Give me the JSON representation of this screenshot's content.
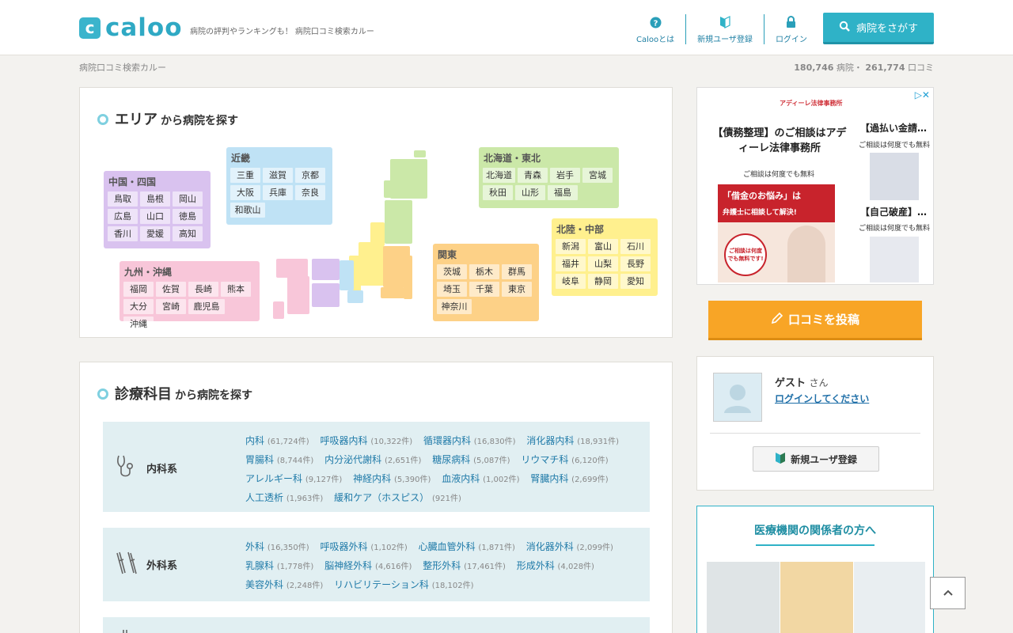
{
  "header": {
    "logo_mark": "c",
    "logo_text": "caloo",
    "tagline": "病院の評判やランキングも！ 病院口コミ検索カルー",
    "nav": [
      {
        "label": "Calooとは",
        "icon": "question-icon"
      },
      {
        "label": "新規ユーザ登録",
        "icon": "beginner-mark-icon"
      },
      {
        "label": "ログイン",
        "icon": "lock-icon"
      }
    ],
    "search_button": "病院をさがす"
  },
  "breadcrumb": "病院口コミ検索カルー",
  "stats": {
    "hospitals": "180,746",
    "hospitals_unit": "病院・",
    "reviews": "261,774",
    "reviews_unit": "口コミ"
  },
  "area": {
    "title_big": "エリア",
    "title_small": "から病院を探す",
    "regions": {
      "chugoku": {
        "name": "中国・四国",
        "color": "#d9c2ef",
        "prefs": [
          "鳥取",
          "島根",
          "岡山",
          "広島",
          "山口",
          "徳島",
          "香川",
          "愛媛",
          "高知"
        ]
      },
      "kinki": {
        "name": "近畿",
        "color": "#bfe2f5",
        "prefs": [
          "三重",
          "滋賀",
          "京都",
          "大阪",
          "兵庫",
          "奈良",
          "和歌山"
        ]
      },
      "tohoku": {
        "name": "北海道・東北",
        "color": "#cbe8a8",
        "prefs": [
          "北海道",
          "青森",
          "岩手",
          "宮城",
          "秋田",
          "山形",
          "福島"
        ]
      },
      "hokuriku": {
        "name": "北陸・中部",
        "color": "#fff08e",
        "prefs": [
          "新潟",
          "富山",
          "石川",
          "福井",
          "山梨",
          "長野",
          "岐阜",
          "静岡",
          "愛知"
        ]
      },
      "kanto": {
        "name": "関東",
        "color": "#fdd187",
        "prefs": [
          "茨城",
          "栃木",
          "群馬",
          "埼玉",
          "千葉",
          "東京",
          "神奈川"
        ]
      },
      "kyushu": {
        "name": "九州・沖縄",
        "color": "#f8c6d9",
        "prefs": [
          "福岡",
          "佐賀",
          "長崎",
          "熊本",
          "大分",
          "宮崎",
          "鹿児島",
          "沖縄"
        ]
      }
    }
  },
  "departments": {
    "title_big": "診療科目",
    "title_small": "から病院を探す",
    "groups": [
      {
        "label": "内科系",
        "icon": "stethoscope-icon",
        "items": [
          {
            "name": "内科",
            "count": "(61,724件)"
          },
          {
            "name": "呼吸器内科",
            "count": "(10,322件)"
          },
          {
            "name": "循環器内科",
            "count": "(16,830件)"
          },
          {
            "name": "消化器内科",
            "count": "(18,931件)"
          },
          {
            "name": "胃腸科",
            "count": "(8,744件)"
          },
          {
            "name": "内分泌代謝科",
            "count": "(2,651件)"
          },
          {
            "name": "糖尿病科",
            "count": "(5,087件)"
          },
          {
            "name": "リウマチ科",
            "count": "(6,120件)"
          },
          {
            "name": "アレルギー科",
            "count": "(9,127件)"
          },
          {
            "name": "神経内科",
            "count": "(5,390件)"
          },
          {
            "name": "血液内科",
            "count": "(1,002件)"
          },
          {
            "name": "腎臓内科",
            "count": "(2,699件)"
          },
          {
            "name": "人工透析",
            "count": "(1,963件)"
          },
          {
            "name": "緩和ケア（ホスピス）",
            "count": "(921件)"
          }
        ]
      },
      {
        "label": "外科系",
        "icon": "crutches-icon",
        "items": [
          {
            "name": "外科",
            "count": "(16,350件)"
          },
          {
            "name": "呼吸器外科",
            "count": "(1,102件)"
          },
          {
            "name": "心臓血管外科",
            "count": "(1,871件)"
          },
          {
            "name": "消化器外科",
            "count": "(2,099件)"
          },
          {
            "name": "乳腺科",
            "count": "(1,778件)"
          },
          {
            "name": "脳神経外科",
            "count": "(4,616件)"
          },
          {
            "name": "整形外科",
            "count": "(17,461件)"
          },
          {
            "name": "形成外科",
            "count": "(4,028件)"
          },
          {
            "name": "美容外科",
            "count": "(2,248件)"
          },
          {
            "name": "リハビリテーション科",
            "count": "(18,102件)"
          }
        ]
      }
    ]
  },
  "ad": {
    "brand": "アディーレ法律事務所",
    "headline": "【債務整理】のご相談はアディーレ法律事務所",
    "sub": "ご相談は何度でも無料",
    "banner_text1": "「借金のお悩み」は",
    "banner_text2": "弁護士に相談して解決!",
    "banner_badge": "ご相談は何度でも無料です!",
    "side1_title": "【過払い金請…",
    "side1_sub": "ご相談は何度でも無料",
    "side2_title": "【自己破産】…",
    "side2_sub": "ご相談は何度でも無料"
  },
  "post_button": "口コミを投稿",
  "user": {
    "name": "ゲスト",
    "suffix": "さん",
    "login_link": "ログインしてください",
    "register_button": "新規ユーザ登録"
  },
  "medical": {
    "title": "医療機関の関係者の方へ"
  },
  "colors": {
    "accent": "#2fb2c7",
    "link": "#1f7aa8",
    "orange": "#f8a526"
  }
}
